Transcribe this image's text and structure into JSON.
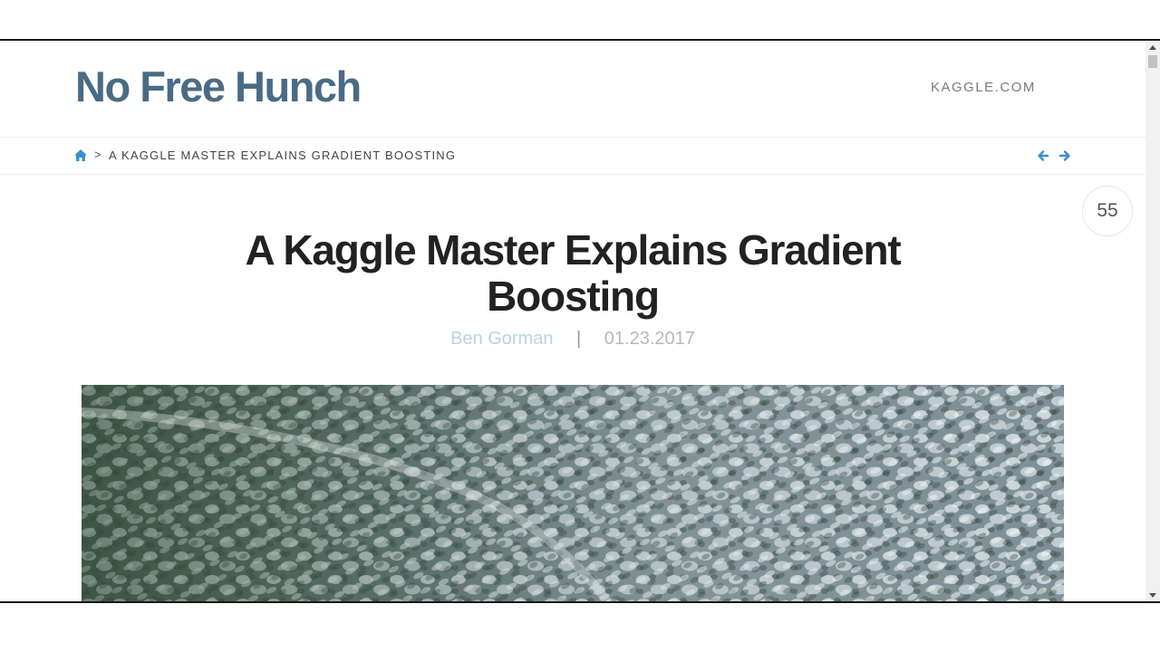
{
  "header": {
    "site_title": "No Free Hunch",
    "site_link": "KAGGLE.COM"
  },
  "breadcrumb": {
    "home_icon": "home-icon",
    "separator": ">",
    "current": "A KAGGLE MASTER EXPLAINS GRADIENT BOOSTING",
    "prev_icon": "arrow-left-icon",
    "next_icon": "arrow-right-icon"
  },
  "comments": {
    "count": "55"
  },
  "post": {
    "title": "A Kaggle Master Explains Gradient Boosting",
    "author": "Ben Gorman",
    "meta_separator": "|",
    "date": "01.23.2017",
    "hero_image": "aerial-snowy-forest-photo"
  },
  "colors": {
    "brand": "#4a6b85",
    "link_accent": "#3a8fd0",
    "author": "#b7d3e2",
    "title": "#222222"
  }
}
